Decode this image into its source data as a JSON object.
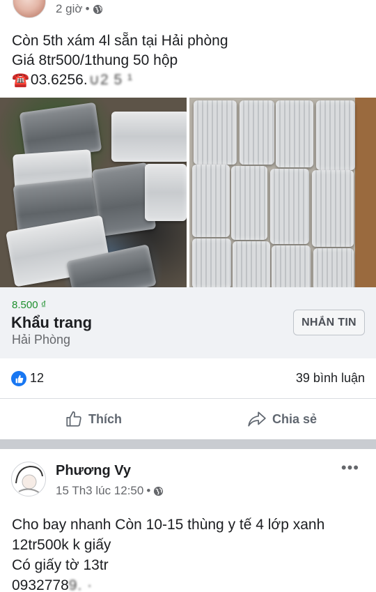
{
  "post1": {
    "time": "2 giờ",
    "separator": "•",
    "lines": [
      "Còn 5th xám 4l sẵn tại Hải phòng",
      "Giá 8tr500/1thung 50 hộp"
    ],
    "phone_icon": "☎️",
    "phone_visible": "03.6256.",
    "phone_blurred": "∪2 5 ¹"
  },
  "listing": {
    "price": "8.500 ₫",
    "product": "Khẩu trang",
    "location": "Hải Phòng",
    "message_button": "NHẮN TIN"
  },
  "reactions": {
    "like_count": "12",
    "comments": "39 bình luận"
  },
  "actions": {
    "like_label": "Thích",
    "share_label": "Chia sẻ"
  },
  "post2": {
    "author": "Phương Vy",
    "time": "15 Th3 lúc 12:50",
    "separator": "•",
    "more": "•••",
    "lines": [
      "Cho bay nhanh Còn 10-15 thùng y tế 4 lớp xanh",
      "12tr500k k giấy",
      "Có giấy tờ 13tr"
    ],
    "phone_visible": "0932778",
    "phone_blurred": "9. ·"
  },
  "colors": {
    "price_green": "#1d8f2d",
    "facebook_blue": "#1877f2",
    "secondary_text": "#65676b",
    "listing_bg": "#f0f2f5"
  },
  "icons": {
    "privacy": "globe-icon",
    "like": "thumbs-up-icon",
    "share": "share-arrow-icon",
    "reaction": "like-reaction-icon"
  }
}
